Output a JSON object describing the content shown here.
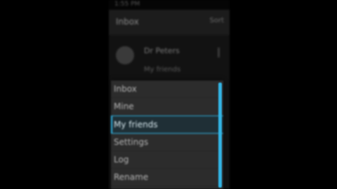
{
  "status_bar": {
    "time": "1:55 PM"
  },
  "header": {
    "title": "Inbox",
    "action_label": "Sort"
  },
  "profile": {
    "name": "Dr Peters",
    "subtitle": "My friends"
  },
  "menu": {
    "items": [
      {
        "label": "Inbox",
        "selected": false
      },
      {
        "label": "Mine",
        "selected": false
      },
      {
        "label": "My friends",
        "selected": true
      },
      {
        "label": "Settings",
        "selected": false
      },
      {
        "label": "Log",
        "selected": false
      },
      {
        "label": "Rename",
        "selected": false
      }
    ]
  },
  "colors": {
    "accent": "#33b5e5",
    "background": "#000000",
    "menu_background": "#2c2c2c"
  }
}
